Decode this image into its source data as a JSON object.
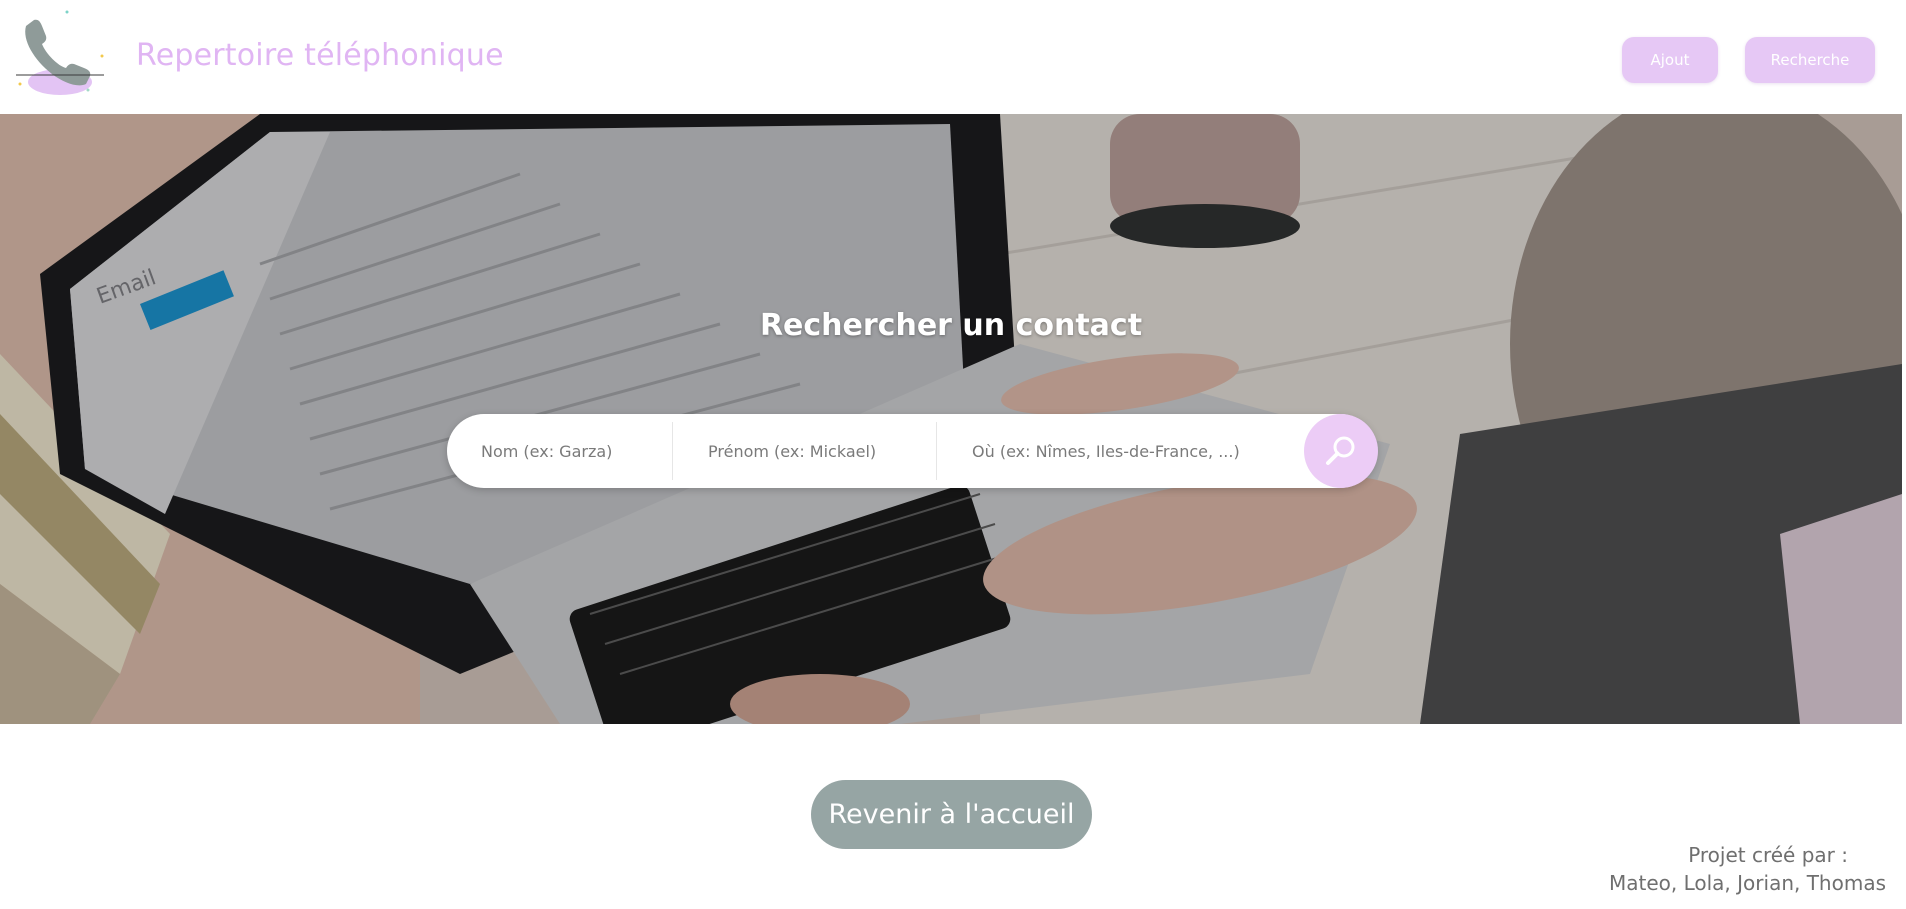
{
  "header": {
    "title": "Repertoire téléphonique",
    "logo_icon": "phone-icon",
    "nav": {
      "ajout_label": "Ajout",
      "recherche_label": "Recherche"
    }
  },
  "hero": {
    "title": "Rechercher un contact",
    "search": {
      "nom_placeholder": "Nom (ex: Garza)",
      "prenom_placeholder": "Prénom (ex: Mickael)",
      "ou_placeholder": "Où (ex: Nîmes, Iles-de-France, ...)",
      "submit_icon": "search-icon"
    },
    "background_screen_label": "Email"
  },
  "home_button_label": "Revenir à l'accueil",
  "credits": {
    "line1": "Projet créé par :",
    "line2": "Mateo, Lola, Jorian, Thomas"
  },
  "colors": {
    "accent": "#e0b5f3",
    "button_lilac": "#e6c8f5",
    "home_button": "#96a5a4"
  }
}
